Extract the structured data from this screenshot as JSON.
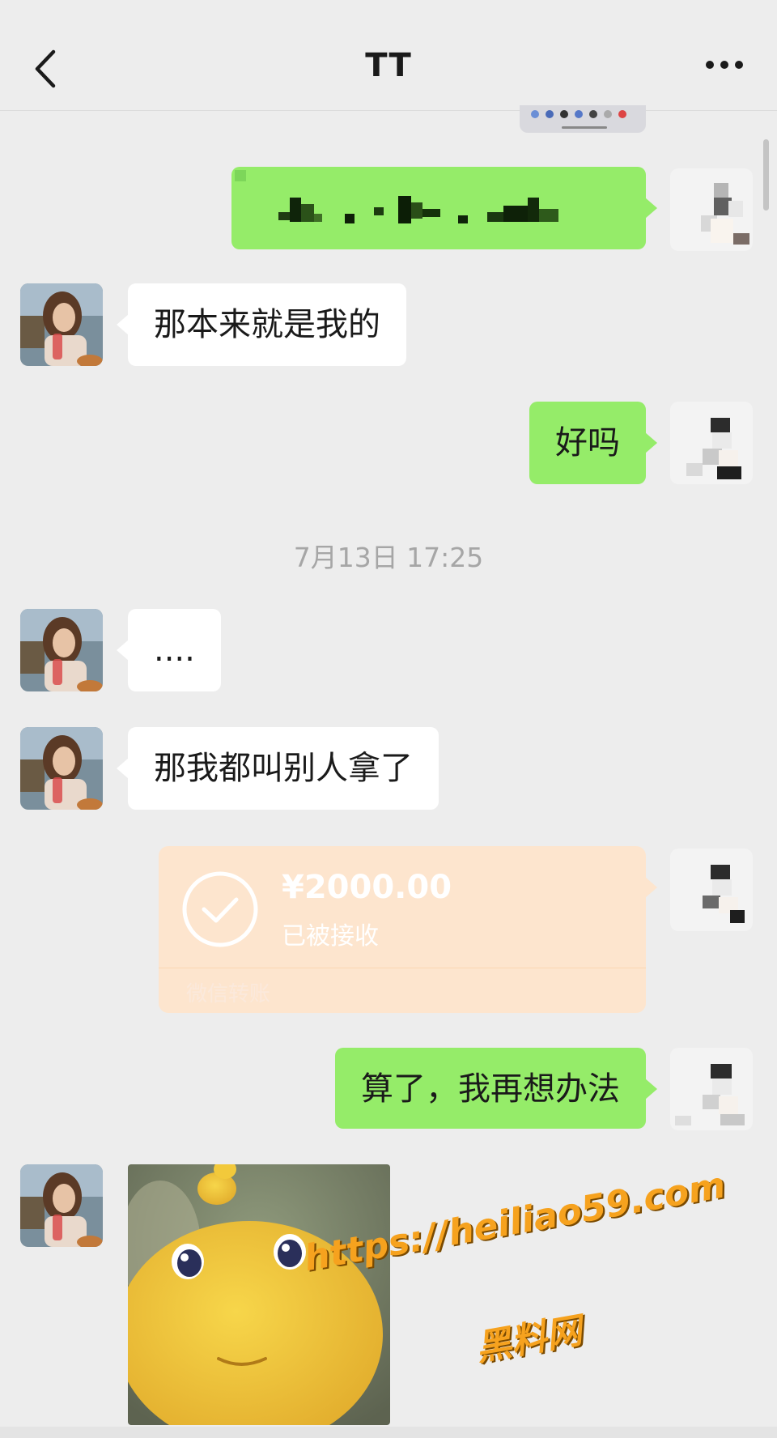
{
  "header": {
    "title": "TT",
    "back_icon": "chevron-left-icon",
    "more_icon": "ellipsis-icon"
  },
  "messages": [
    {
      "side": "right",
      "type": "text",
      "text": "（文字已打码）",
      "pixelated": true
    },
    {
      "side": "left",
      "type": "text",
      "text": "那本来就是我的"
    },
    {
      "side": "right",
      "type": "text",
      "text": "好吗"
    },
    {
      "side": "left",
      "type": "text",
      "text": "...."
    },
    {
      "side": "left",
      "type": "text",
      "text": "那我都叫别人拿了"
    },
    {
      "side": "right",
      "type": "transfer",
      "amount": "¥2000.00",
      "status": "已被接收",
      "footer": "微信转账"
    },
    {
      "side": "right",
      "type": "text",
      "text": "算了，我再想办法"
    },
    {
      "side": "left",
      "type": "sticker",
      "sticker": "yellow-dinosaur-sticker"
    }
  ],
  "timestamp": "7月13日 17:25",
  "watermark": {
    "url": "https://heiliao59.com",
    "text": "黑料网"
  },
  "colors": {
    "background": "#ededed",
    "bubble_green": "#95ec69",
    "bubble_white": "#ffffff",
    "transfer_accepted": "#fde5ce",
    "timestamp_text": "#a6a6a6",
    "watermark": "#f6a21e"
  }
}
